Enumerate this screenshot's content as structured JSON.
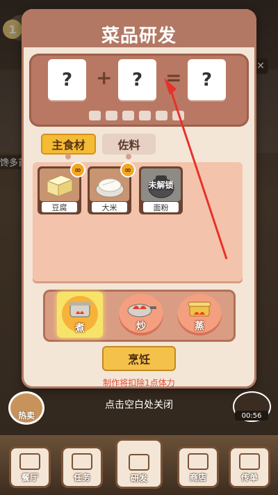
{
  "background": {
    "left_side_text": "馋多首",
    "badge": "1"
  },
  "dialog": {
    "title": "菜品研发",
    "formula": {
      "slot_1": "?",
      "plus": "+",
      "slot_2": "?",
      "equals": "=",
      "result": "?"
    },
    "tabs": {
      "main": "主食材",
      "side": "佐料"
    },
    "ingredients": [
      {
        "label": "豆腐",
        "icon": "tofu-icon",
        "badge": "∞"
      },
      {
        "label": "大米",
        "icon": "rice-icon",
        "badge": "∞"
      },
      {
        "label": "面粉",
        "icon": "flour-icon",
        "locked_text": "未解锁"
      }
    ],
    "methods": [
      {
        "label": "煮",
        "icon": "boil-pot-icon",
        "selected": true
      },
      {
        "label": "炒",
        "icon": "stir-fry-pan-icon"
      },
      {
        "label": "蒸",
        "icon": "steamer-icon"
      }
    ],
    "cook_button": "烹饪",
    "cost_note": "制作将扣除1点体力"
  },
  "close_hint": "点击空白处关闭",
  "side_buttons": {
    "hot_sale": "热卖",
    "timer": "00:56"
  },
  "bottom_nav": [
    {
      "label": "餐厅",
      "icon": "restaurant-icon"
    },
    {
      "label": "任务",
      "icon": "task-icon"
    },
    {
      "label": "研发",
      "icon": "research-icon"
    },
    {
      "label": "商店",
      "icon": "shop-icon"
    },
    {
      "label": "传单",
      "icon": "flyer-icon"
    }
  ],
  "colors": {
    "accent_orange": "#f4bb34",
    "panel": "#f3e6d6",
    "header": "#b27864",
    "warning_red": "#e24a3a",
    "arrow_red": "#e8302a"
  }
}
